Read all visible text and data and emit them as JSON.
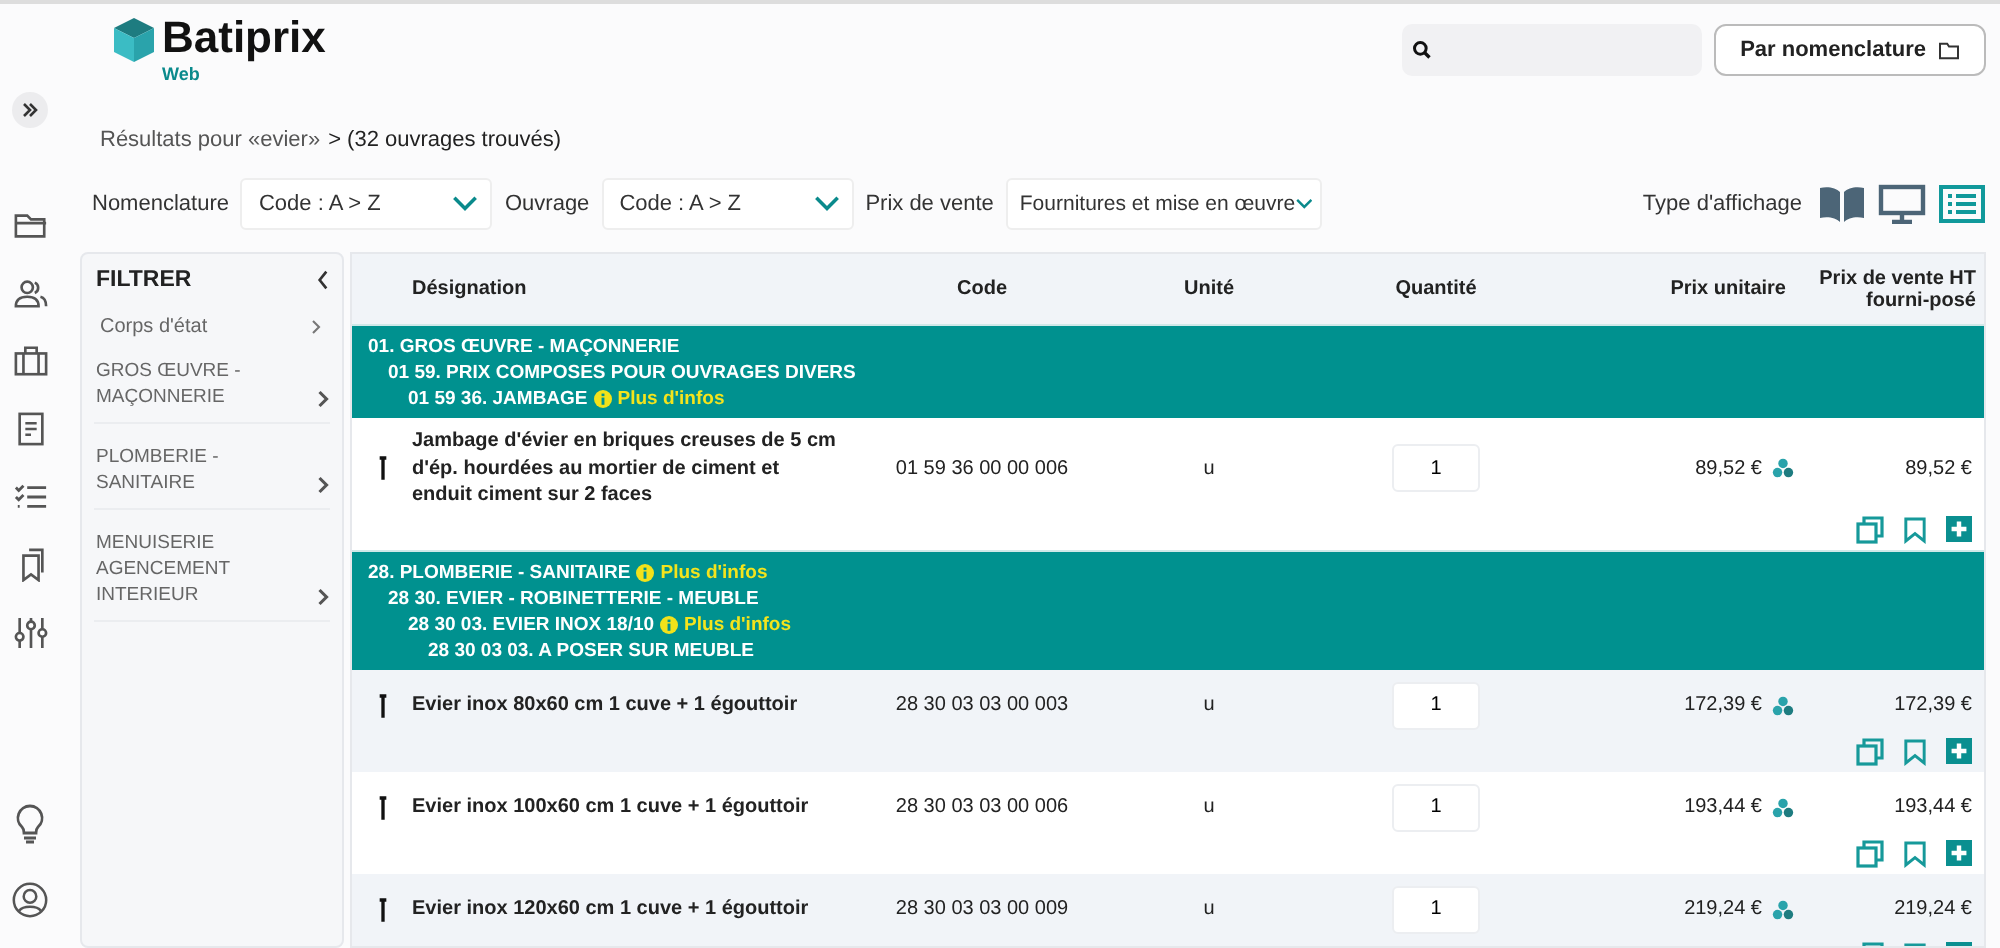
{
  "logo": {
    "name": "Batiprix",
    "sub": "Web"
  },
  "nomenclature_button": "Par nomenclature",
  "breadcrumb": {
    "query": "Résultats pour «evier»",
    "count": "> (32 ouvrages trouvés)"
  },
  "filters": [
    {
      "label": "Nomenclature",
      "value": "Code : A > Z"
    },
    {
      "label": "Ouvrage",
      "value": "Code : A > Z"
    },
    {
      "label": "Prix de vente",
      "value": "Fournitures et mise en œuvre"
    }
  ],
  "view": {
    "label": "Type d'affichage",
    "options": [
      {
        "kind": "book",
        "selected": false
      },
      {
        "kind": "monitor",
        "selected": false
      },
      {
        "kind": "list",
        "selected": true
      }
    ]
  },
  "filter_panel": {
    "title": "FILTRER",
    "heading": "Corps d'état",
    "items": [
      "GROS ŒUVRE - MAÇONNERIE",
      "PLOMBERIE - SANITAIRE",
      "MENUISERIE AGENCEMENT INTERIEUR"
    ]
  },
  "table": {
    "columns": [
      "Désignation",
      "Code",
      "Unité",
      "Quantité",
      "Prix unitaire",
      "Prix de vente HT fourni-posé"
    ],
    "rows": [
      {
        "kind": "group",
        "label": "01. GROS ŒUVRE - MAÇONNERIE",
        "children": [
          {
            "label": "01 59. PRIX COMPOSES POUR OUVRAGES DIVERS",
            "children": [
              {
                "label": "01 59 36. JAMBAGE",
                "info": "Plus d'infos"
              }
            ]
          }
        ]
      },
      {
        "kind": "item",
        "designation": "Jambage d'évier en briques creuses de 5 cm d'ép. hourdées au mortier de ciment et enduit ciment sur 2 faces",
        "code": "01 59 36 00 00 006",
        "unit": "u",
        "quantity": "1",
        "unit_price": "89,52 €",
        "total": "89,52 €"
      },
      {
        "kind": "group",
        "label": "28. PLOMBERIE - SANITAIRE",
        "info": "Plus d'infos",
        "children": [
          {
            "label": "28 30. EVIER - ROBINETTERIE - MEUBLE",
            "children": [
              {
                "label": "28 30 03. EVIER INOX 18/10",
                "info": "Plus d'infos",
                "children": [
                  {
                    "label": "28 30 03 03. A POSER SUR MEUBLE"
                  }
                ]
              }
            ]
          }
        ]
      },
      {
        "kind": "item",
        "designation": "Evier inox 80x60 cm 1 cuve + 1 égouttoir",
        "code": "28 30 03 03 00 003",
        "unit": "u",
        "quantity": "1",
        "unit_price": "172,39 €",
        "total": "172,39 €"
      },
      {
        "kind": "item",
        "designation": "Evier inox 100x60 cm 1 cuve + 1 égouttoir",
        "code": "28 30 03 03 00 006",
        "unit": "u",
        "quantity": "1",
        "unit_price": "193,44 €",
        "total": "193,44 €"
      },
      {
        "kind": "item",
        "designation": "Evier inox 120x60 cm 1 cuve + 1 égouttoir",
        "code": "28 30 03 03 00 009",
        "unit": "u",
        "quantity": "1",
        "unit_price": "219,24 €",
        "total": "219,24 €"
      }
    ]
  }
}
